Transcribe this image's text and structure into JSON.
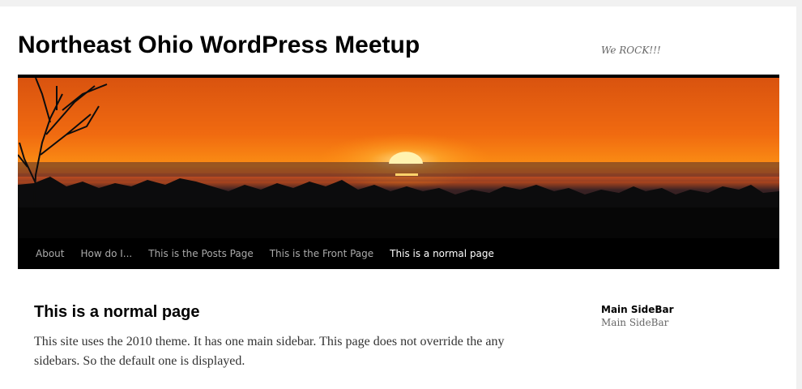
{
  "site": {
    "title": "Northeast Ohio WordPress Meetup",
    "description": "We ROCK!!!"
  },
  "header_image": {
    "description": "Sunset over a treeline silhouette",
    "colors": {
      "sky_top": "#e25813",
      "sky_glow": "#fa8c0f",
      "sun": "#ffe08a",
      "silhouette": "#0c0c0d"
    }
  },
  "nav": {
    "items": [
      {
        "label": "About"
      },
      {
        "label": "How do I..."
      },
      {
        "label": "This is the Posts Page"
      },
      {
        "label": "This is the Front Page"
      },
      {
        "label": "This is a normal page",
        "current": true
      }
    ]
  },
  "page": {
    "title": "This is a normal page",
    "content": "This site uses the 2010 theme. It has one main sidebar. This page does not override the any sidebars. So the default one is displayed."
  },
  "sidebar": {
    "widget_title": "Main SideBar",
    "widget_text": "Main SideBar"
  },
  "colors": {
    "page_background": "#f1f1f1",
    "content_background": "#ffffff",
    "nav_background": "#000000",
    "nav_text": "#aaaaaa",
    "nav_current_text": "#ffffff"
  }
}
